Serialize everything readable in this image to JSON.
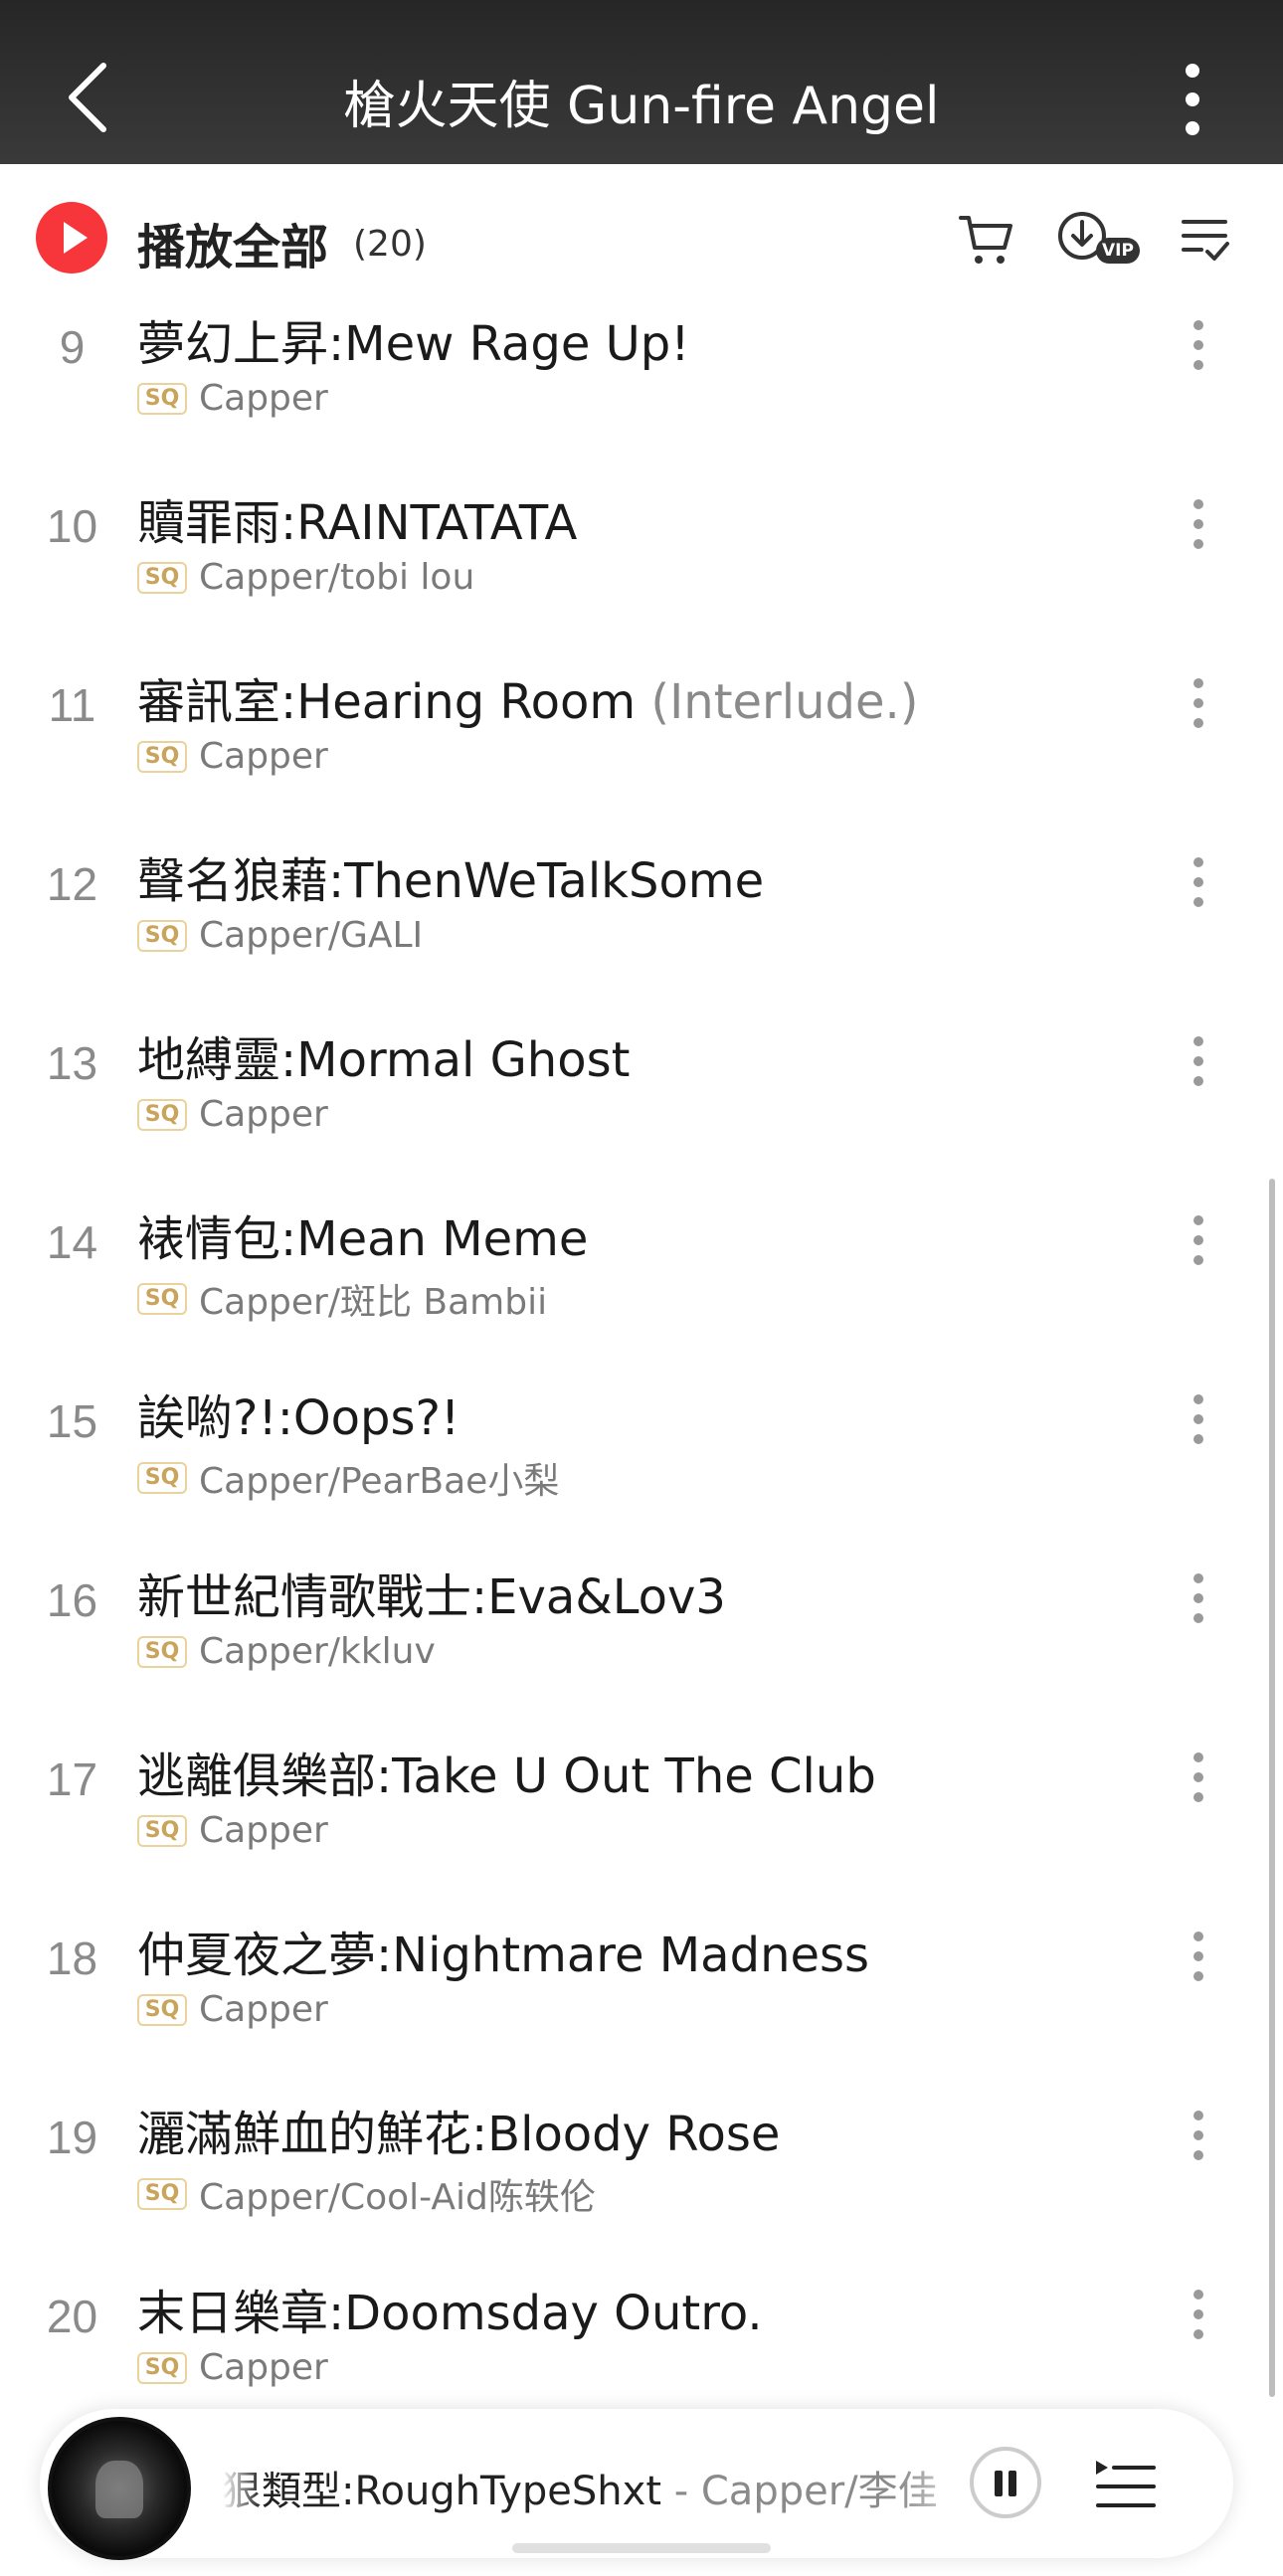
{
  "header": {
    "title": "槍火天使 Gun-fire Angel"
  },
  "playall": {
    "label": "播放全部",
    "count": "(20)",
    "vip_badge": "VIP"
  },
  "quality_badge": "SQ",
  "tracks": [
    {
      "index": "9",
      "title": "夢幻上昇:Mew Rage Up!",
      "suffix": "",
      "artist": "Capper"
    },
    {
      "index": "10",
      "title": "贖罪雨:RAINTATATA",
      "suffix": "",
      "artist": "Capper/tobi lou"
    },
    {
      "index": "11",
      "title": "審訊室:Hearing Room ",
      "suffix": "(Interlude.)",
      "artist": "Capper"
    },
    {
      "index": "12",
      "title": "聲名狼藉:ThenWeTalkSome",
      "suffix": "",
      "artist": "Capper/GALI"
    },
    {
      "index": "13",
      "title": "地縛靈:Mormal Ghost",
      "suffix": "",
      "artist": "Capper"
    },
    {
      "index": "14",
      "title": "裱情包:Mean Meme",
      "suffix": "",
      "artist": "Capper/斑比 Bambii"
    },
    {
      "index": "15",
      "title": "誒喲?!:Oops?!",
      "suffix": "",
      "artist": "Capper/PearBae小梨"
    },
    {
      "index": "16",
      "title": "新世紀情歌戰士:Eva&Lov3",
      "suffix": "",
      "artist": "Capper/kkluv"
    },
    {
      "index": "17",
      "title": "逃離俱樂部:Take U Out The Club",
      "suffix": "",
      "artist": "Capper"
    },
    {
      "index": "18",
      "title": "仲夏夜之夢:Nightmare Madness",
      "suffix": "",
      "artist": "Capper"
    },
    {
      "index": "19",
      "title": "灑滿鮮血的鮮花:Bloody Rose",
      "suffix": "",
      "artist": "Capper/Cool-Aid陈轶伦"
    },
    {
      "index": "20",
      "title": "末日樂章:Doomsday Outro.",
      "suffix": "",
      "artist": "Capper"
    }
  ],
  "player": {
    "song": "狠類型:RoughTypeShxt",
    "artist": " - Capper/李佳"
  },
  "colors": {
    "accent": "#f7363b",
    "header_bg": "#2e2e2e",
    "sq_border": "#ead39a"
  }
}
